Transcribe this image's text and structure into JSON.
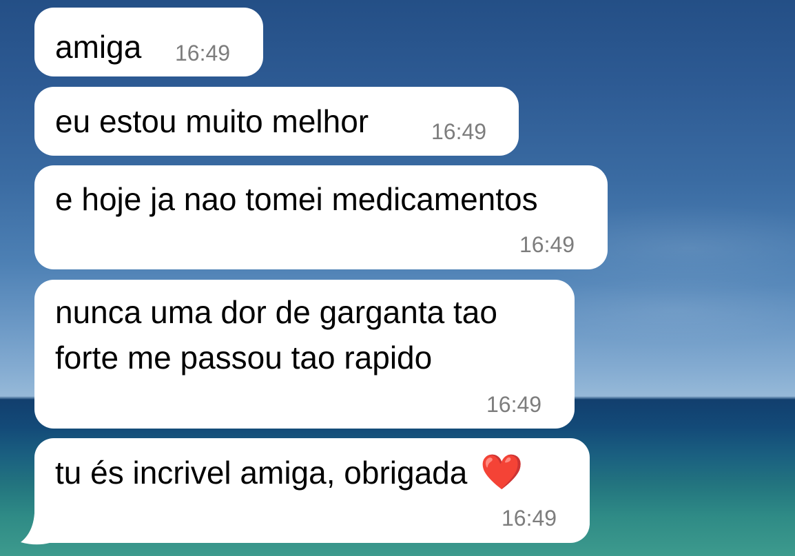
{
  "chat": {
    "messages": [
      {
        "text": "amiga",
        "time": "16:49"
      },
      {
        "text": "eu estou muito melhor",
        "time": "16:49"
      },
      {
        "text": "e hoje ja nao tomei medicamentos",
        "time": "16:49"
      },
      {
        "lines": [
          "nunca uma dor de garganta tao",
          "forte me passou tao rapido"
        ],
        "time": "16:49"
      },
      {
        "text": "tu és incrivel amiga, obrigada",
        "emoji": "❤️",
        "time": "16:49"
      }
    ],
    "bubble_color": "#ffffff",
    "timestamp_color": "#7d7d7d"
  }
}
